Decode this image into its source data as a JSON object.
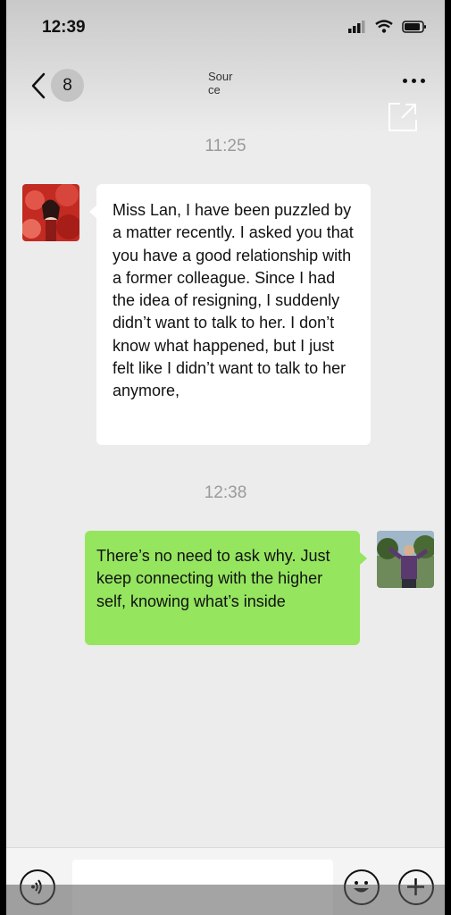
{
  "status": {
    "time": "12:39"
  },
  "nav": {
    "badge": "8",
    "title": "Sour\nce"
  },
  "messages": [
    {
      "direction": "incoming",
      "timestamp": "11:25",
      "text": "Miss Lan, I have been puzzled by a matter recently. I asked you that you have a good relationship with a former colleague. Since I had the idea of resigning, I suddenly didn’t want to talk to her. I don’t know what happened, but I just felt like I didn’t want to talk to her anymore,"
    },
    {
      "direction": "outgoing",
      "timestamp": "12:38",
      "text": "There’s no need to ask why. Just keep connecting with the higher self, knowing what’s inside"
    }
  ],
  "input": {
    "placeholder": ""
  },
  "icons": {
    "back": "chevron-left-icon",
    "more": "more-dots-icon",
    "share": "share-external-icon",
    "voice": "voice-icon",
    "emoji": "emoji-icon",
    "plus": "plus-icon",
    "signal": "signal-icon",
    "wifi": "wifi-icon",
    "battery": "battery-icon"
  },
  "colors": {
    "outgoing_bubble": "#95e55f",
    "incoming_bubble": "#ffffff",
    "background": "#ececec"
  }
}
